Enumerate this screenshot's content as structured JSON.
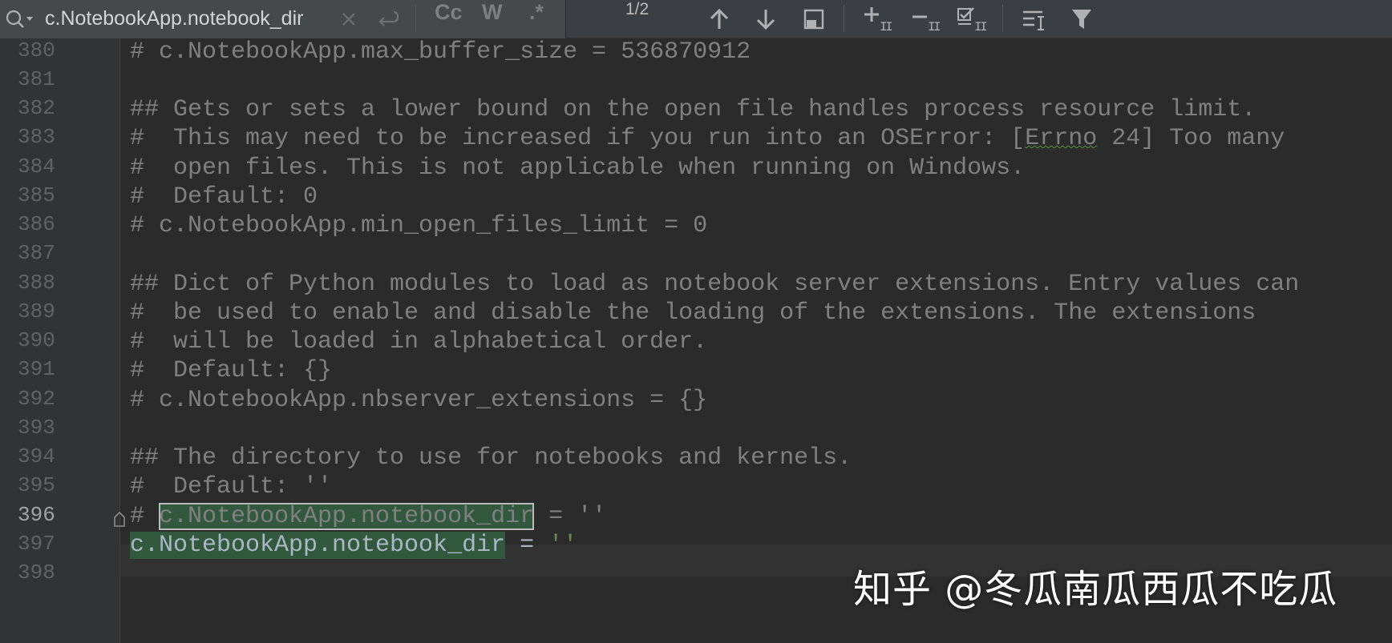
{
  "search": {
    "value": "c.NotebookApp.notebook_dir",
    "match_case_label": "Cc",
    "words_label": "W",
    "regex_label": ".*",
    "match_count": "1/2"
  },
  "editor": {
    "current_line": "396",
    "lines": [
      {
        "no": "380",
        "text": "# c.NotebookApp.max_buffer_size = 536870912"
      },
      {
        "no": "381",
        "text": ""
      },
      {
        "no": "382",
        "text": "## Gets or sets a lower bound on the open file handles process resource limit."
      },
      {
        "no": "383",
        "pre": "#  This may need to be increased if you run into an OSError: [",
        "mid": "Errno",
        "post": " 24] Too many"
      },
      {
        "no": "384",
        "text": "#  open files. This is not applicable when running on Windows."
      },
      {
        "no": "385",
        "text": "#  Default: 0"
      },
      {
        "no": "386",
        "text": "# c.NotebookApp.min_open_files_limit = 0"
      },
      {
        "no": "387",
        "text": ""
      },
      {
        "no": "388",
        "text": "## Dict of Python modules to load as notebook server extensions. Entry values can"
      },
      {
        "no": "389",
        "text": "#  be used to enable and disable the loading of the extensions. The extensions"
      },
      {
        "no": "390",
        "text": "#  will be loaded in alphabetical order."
      },
      {
        "no": "391",
        "text": "#  Default: {}"
      },
      {
        "no": "392",
        "text": "# c.NotebookApp.nbserver_extensions = {}"
      },
      {
        "no": "393",
        "text": ""
      },
      {
        "no": "394",
        "text": "## The directory to use for notebooks and kernels."
      },
      {
        "no": "395",
        "text": "#  Default: ''"
      },
      {
        "no": "396",
        "pre": "# ",
        "mid": "c.NotebookApp.notebook_dir",
        "post": " = ''"
      },
      {
        "no": "397",
        "mid": "c.NotebookApp.notebook_dir",
        "post": " = ''"
      },
      {
        "no": "398",
        "text": ""
      }
    ]
  },
  "watermark": "知乎 @冬瓜南瓜西瓜不吃瓜",
  "colors": {
    "comment": "#808080",
    "string": "#6a8759",
    "match_highlight": "#32593d",
    "toolbar_bg": "#3c3f41",
    "editor_bg": "#2b2b2b"
  }
}
